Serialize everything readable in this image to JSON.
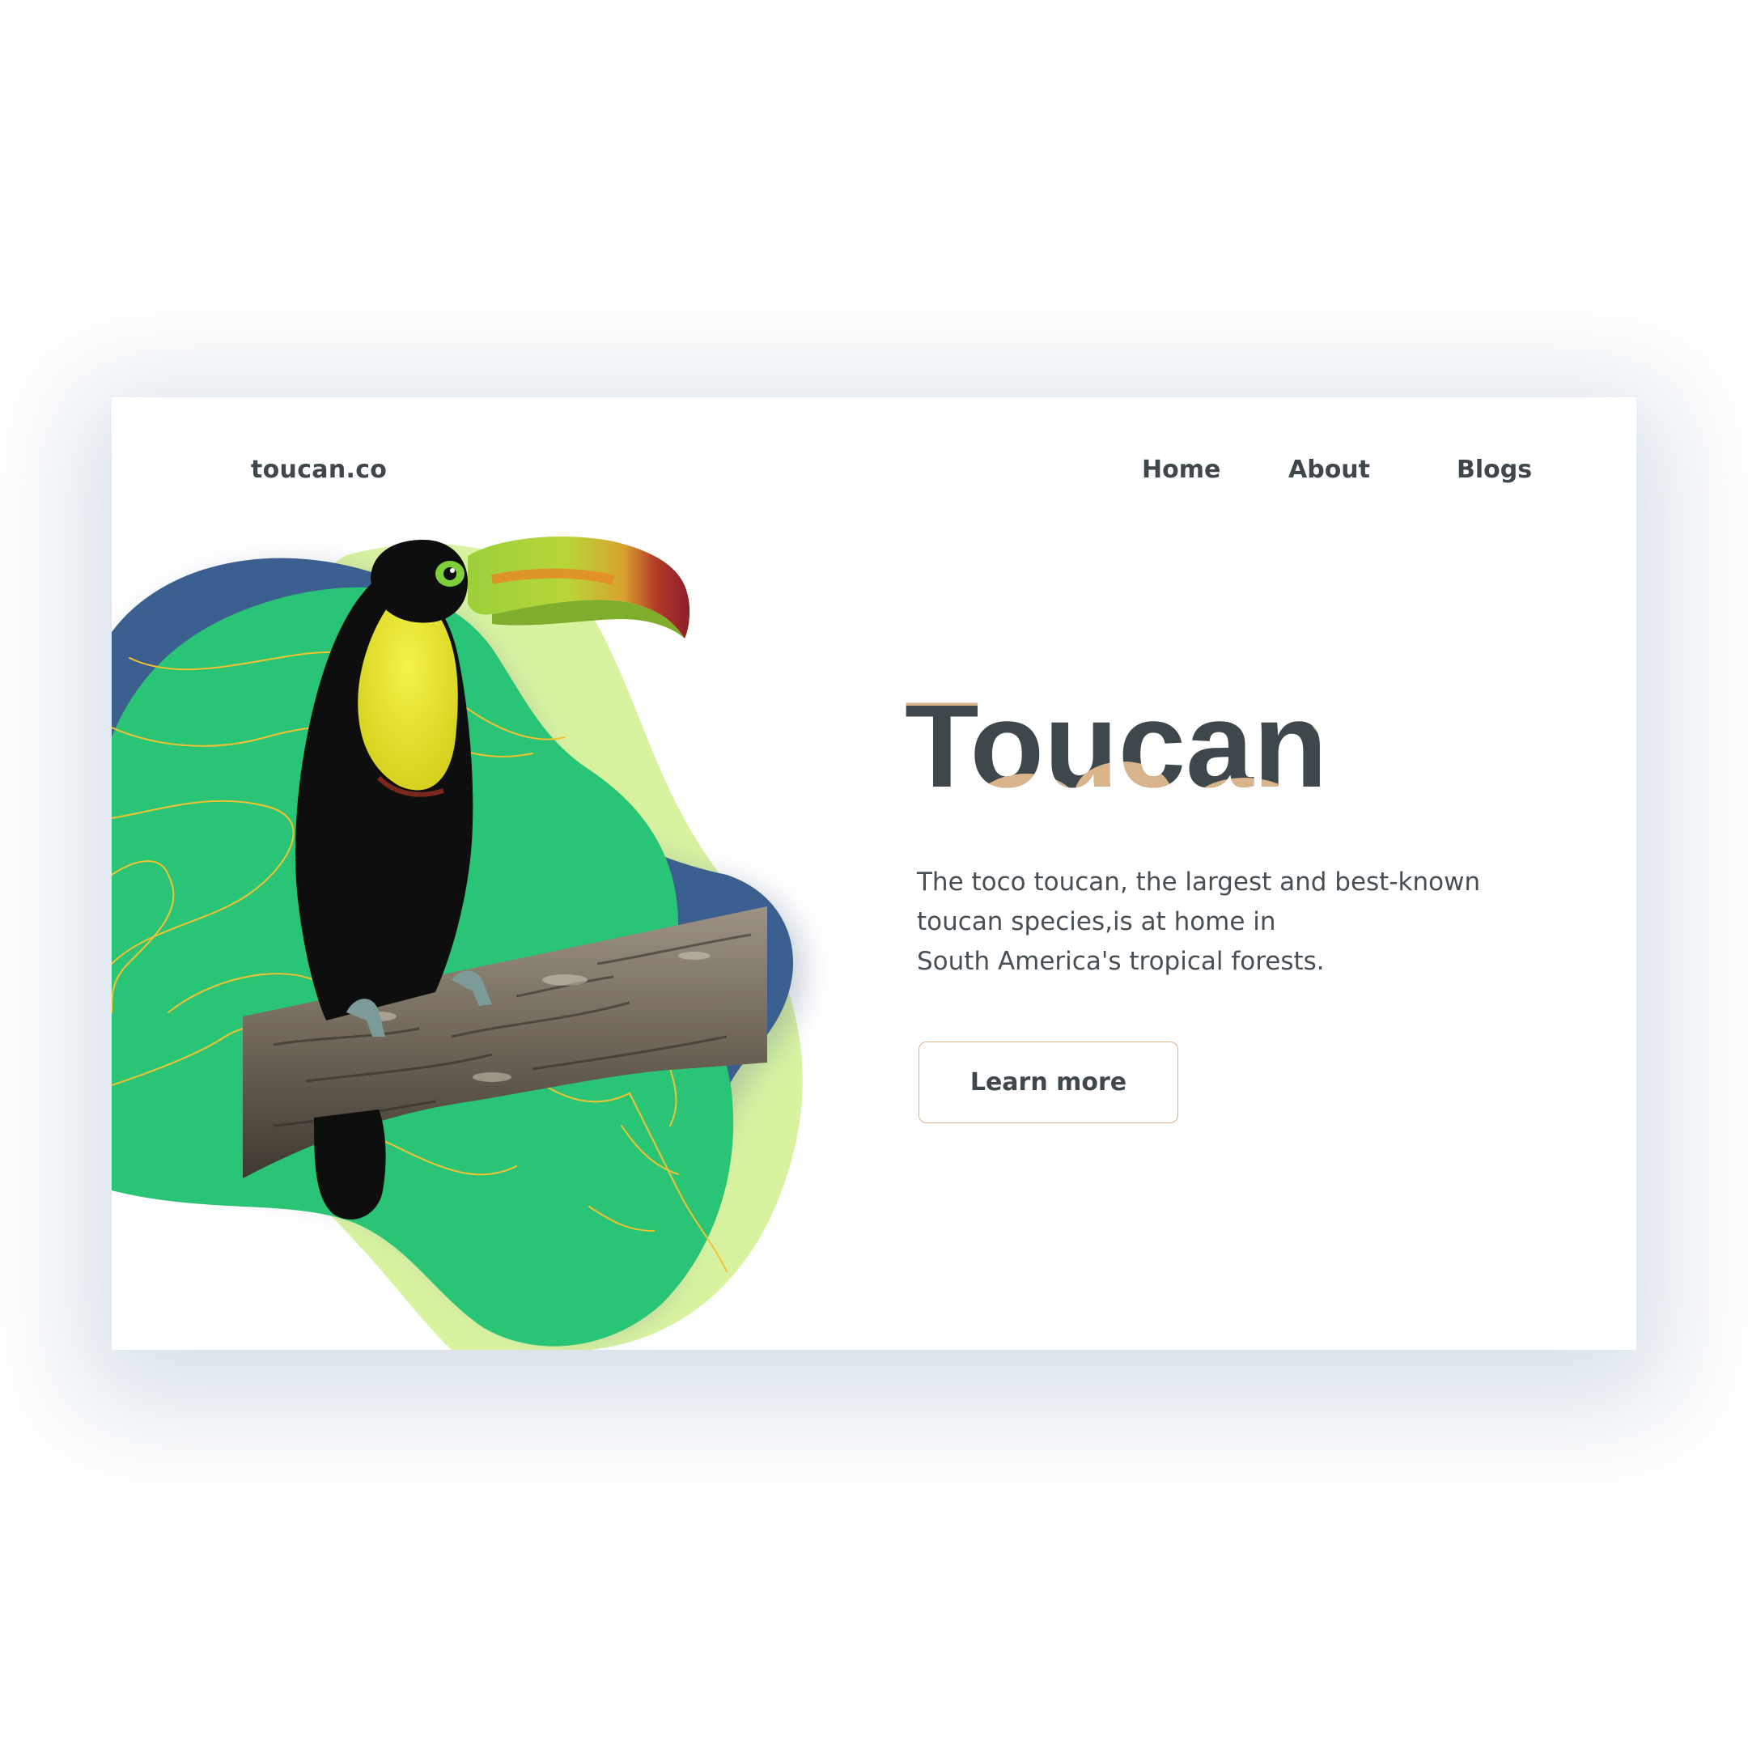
{
  "header": {
    "logo": "toucan.co",
    "nav": {
      "home": "Home",
      "about": "About",
      "blogs": "Blogs"
    }
  },
  "hero": {
    "title": "Toucan",
    "description_lines": [
      "The toco toucan, the largest and best-known",
      "toucan species,is at home in",
      "South America's tropical forests."
    ],
    "cta_label": "Learn more"
  },
  "colors": {
    "text_dark": "#3d474c",
    "accent_tan": "#d9b48a",
    "blob_green": "#29c476",
    "blob_navy": "#3b5f8e",
    "blob_lime": "#d8f3a0",
    "contour_yellow": "#f2c230"
  },
  "icons": {
    "bird": "toucan-illustration",
    "branch": "branch-illustration"
  }
}
